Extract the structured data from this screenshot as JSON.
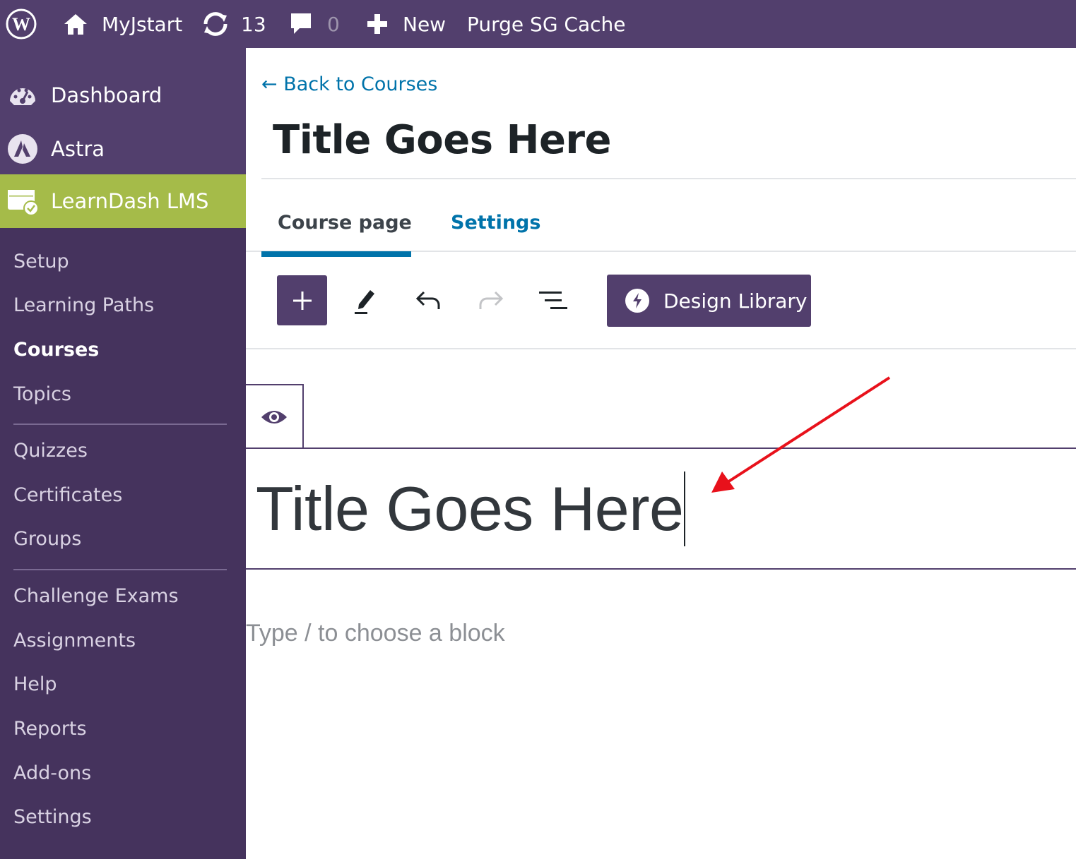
{
  "admin_bar": {
    "site_name": "MyJstart",
    "updates_count": "13",
    "comments_count": "0",
    "new_label": "New",
    "purge_label": "Purge SG Cache"
  },
  "sidebar": {
    "main_items": [
      {
        "label": "Dashboard",
        "icon": "dashboard-icon"
      },
      {
        "label": "Astra",
        "icon": "astra-icon"
      },
      {
        "label": "LearnDash LMS",
        "icon": "learndash-icon"
      }
    ],
    "submenu": [
      {
        "label": "Setup"
      },
      {
        "label": "Learning Paths"
      },
      {
        "label": "Courses"
      },
      {
        "label": "Topics"
      },
      {
        "label": "Quizzes"
      },
      {
        "label": "Certificates"
      },
      {
        "label": "Groups"
      },
      {
        "label": "Challenge Exams"
      },
      {
        "label": "Assignments"
      },
      {
        "label": "Help"
      },
      {
        "label": "Reports"
      },
      {
        "label": "Add-ons"
      },
      {
        "label": "Settings"
      }
    ],
    "current_item": "Courses",
    "active_color": "#a5bb49"
  },
  "header": {
    "back_link": "← Back to Courses",
    "title": "Title Goes Here"
  },
  "tabs": {
    "course_page": "Course page",
    "settings": "Settings"
  },
  "toolbar": {
    "design_library": "Design Library"
  },
  "editor": {
    "title_value": "Title Goes Here",
    "block_placeholder": "Type / to choose a block"
  },
  "colors": {
    "admin_purple": "#523f6d",
    "sidebar_purple": "#45335d",
    "link_blue": "#0073aa",
    "annotation_red": "#e8111b"
  }
}
